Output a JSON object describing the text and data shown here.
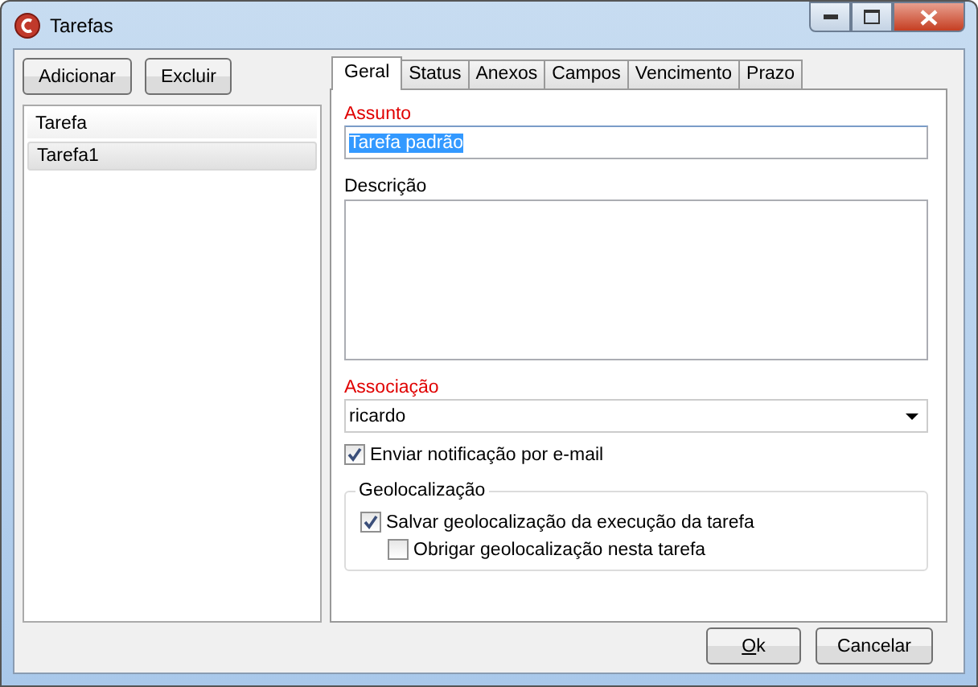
{
  "window": {
    "title": "Tarefas"
  },
  "toolbar": {
    "buttons": [
      "Adicionar",
      "Excluir"
    ]
  },
  "task_list": {
    "items": [
      {
        "label": "Tarefa",
        "selected": false
      },
      {
        "label": "Tarefa1",
        "selected": true
      }
    ]
  },
  "tabs": [
    {
      "label": "Geral",
      "selected": true
    },
    {
      "label": "Status",
      "selected": false
    },
    {
      "label": "Anexos",
      "selected": false
    },
    {
      "label": "Campos",
      "selected": false
    },
    {
      "label": "Vencimento",
      "selected": false
    },
    {
      "label": "Prazo",
      "selected": false
    }
  ],
  "form": {
    "subject": {
      "label": "Assunto",
      "value": "Tarefa padrão",
      "required": true
    },
    "description": {
      "label": "Descrição"
    },
    "association": {
      "label": "Associação",
      "value": "ricardo",
      "required": true
    },
    "notify": {
      "label": "Enviar notificação por e-mail",
      "checked": true
    },
    "geolocation": {
      "legend": "Geolocalização",
      "options": [
        {
          "label": "Salvar geolocalização da execução da tarefa",
          "checked": true,
          "children": [
            {
              "label": "Obrigar geolocalização nesta tarefa",
              "checked": false
            }
          ]
        }
      ]
    }
  },
  "footer": {
    "buttons": [
      {
        "label": "Ok",
        "mnemonic": true
      },
      {
        "label": "Cancelar",
        "mnemonic": false
      }
    ]
  }
}
